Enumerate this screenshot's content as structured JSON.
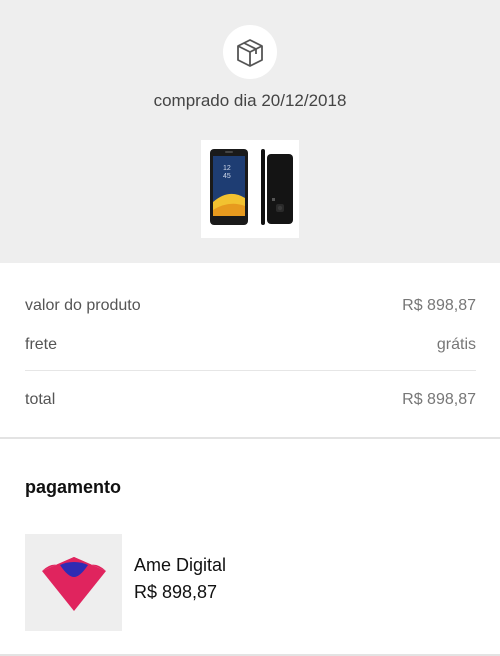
{
  "header": {
    "icon": "package-box-icon",
    "purchase_date": "comprado dia 20/12/2018",
    "product_image": "smartphone-thumbnail"
  },
  "summary": {
    "product_value_label": "valor do produto",
    "product_value": "R$ 898,87",
    "shipping_label": "frete",
    "shipping_value": "grátis",
    "total_label": "total",
    "total_value": "R$ 898,87"
  },
  "payment": {
    "title": "pagamento",
    "method_icon": "ame-digital-logo-icon",
    "method_name": "Ame Digital",
    "amount": "R$ 898,87"
  },
  "colors": {
    "header_bg": "#eeeeee",
    "ame_pink": "#e0245e",
    "ame_blue": "#2f2bb3"
  }
}
